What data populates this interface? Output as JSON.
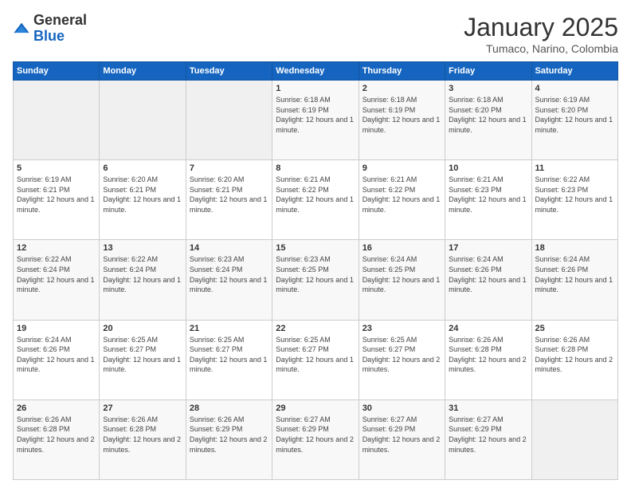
{
  "logo": {
    "general": "General",
    "blue": "Blue"
  },
  "header": {
    "title": "January 2025",
    "subtitle": "Tumaco, Narino, Colombia"
  },
  "days_of_week": [
    "Sunday",
    "Monday",
    "Tuesday",
    "Wednesday",
    "Thursday",
    "Friday",
    "Saturday"
  ],
  "weeks": [
    [
      {
        "day": "",
        "sunrise": "",
        "sunset": "",
        "daylight": "",
        "empty": true
      },
      {
        "day": "",
        "sunrise": "",
        "sunset": "",
        "daylight": "",
        "empty": true
      },
      {
        "day": "",
        "sunrise": "",
        "sunset": "",
        "daylight": "",
        "empty": true
      },
      {
        "day": "1",
        "sunrise": "Sunrise: 6:18 AM",
        "sunset": "Sunset: 6:19 PM",
        "daylight": "Daylight: 12 hours and 1 minute."
      },
      {
        "day": "2",
        "sunrise": "Sunrise: 6:18 AM",
        "sunset": "Sunset: 6:19 PM",
        "daylight": "Daylight: 12 hours and 1 minute."
      },
      {
        "day": "3",
        "sunrise": "Sunrise: 6:18 AM",
        "sunset": "Sunset: 6:20 PM",
        "daylight": "Daylight: 12 hours and 1 minute."
      },
      {
        "day": "4",
        "sunrise": "Sunrise: 6:19 AM",
        "sunset": "Sunset: 6:20 PM",
        "daylight": "Daylight: 12 hours and 1 minute."
      }
    ],
    [
      {
        "day": "5",
        "sunrise": "Sunrise: 6:19 AM",
        "sunset": "Sunset: 6:21 PM",
        "daylight": "Daylight: 12 hours and 1 minute."
      },
      {
        "day": "6",
        "sunrise": "Sunrise: 6:20 AM",
        "sunset": "Sunset: 6:21 PM",
        "daylight": "Daylight: 12 hours and 1 minute."
      },
      {
        "day": "7",
        "sunrise": "Sunrise: 6:20 AM",
        "sunset": "Sunset: 6:21 PM",
        "daylight": "Daylight: 12 hours and 1 minute."
      },
      {
        "day": "8",
        "sunrise": "Sunrise: 6:21 AM",
        "sunset": "Sunset: 6:22 PM",
        "daylight": "Daylight: 12 hours and 1 minute."
      },
      {
        "day": "9",
        "sunrise": "Sunrise: 6:21 AM",
        "sunset": "Sunset: 6:22 PM",
        "daylight": "Daylight: 12 hours and 1 minute."
      },
      {
        "day": "10",
        "sunrise": "Sunrise: 6:21 AM",
        "sunset": "Sunset: 6:23 PM",
        "daylight": "Daylight: 12 hours and 1 minute."
      },
      {
        "day": "11",
        "sunrise": "Sunrise: 6:22 AM",
        "sunset": "Sunset: 6:23 PM",
        "daylight": "Daylight: 12 hours and 1 minute."
      }
    ],
    [
      {
        "day": "12",
        "sunrise": "Sunrise: 6:22 AM",
        "sunset": "Sunset: 6:24 PM",
        "daylight": "Daylight: 12 hours and 1 minute."
      },
      {
        "day": "13",
        "sunrise": "Sunrise: 6:22 AM",
        "sunset": "Sunset: 6:24 PM",
        "daylight": "Daylight: 12 hours and 1 minute."
      },
      {
        "day": "14",
        "sunrise": "Sunrise: 6:23 AM",
        "sunset": "Sunset: 6:24 PM",
        "daylight": "Daylight: 12 hours and 1 minute."
      },
      {
        "day": "15",
        "sunrise": "Sunrise: 6:23 AM",
        "sunset": "Sunset: 6:25 PM",
        "daylight": "Daylight: 12 hours and 1 minute."
      },
      {
        "day": "16",
        "sunrise": "Sunrise: 6:24 AM",
        "sunset": "Sunset: 6:25 PM",
        "daylight": "Daylight: 12 hours and 1 minute."
      },
      {
        "day": "17",
        "sunrise": "Sunrise: 6:24 AM",
        "sunset": "Sunset: 6:26 PM",
        "daylight": "Daylight: 12 hours and 1 minute."
      },
      {
        "day": "18",
        "sunrise": "Sunrise: 6:24 AM",
        "sunset": "Sunset: 6:26 PM",
        "daylight": "Daylight: 12 hours and 1 minute."
      }
    ],
    [
      {
        "day": "19",
        "sunrise": "Sunrise: 6:24 AM",
        "sunset": "Sunset: 6:26 PM",
        "daylight": "Daylight: 12 hours and 1 minute."
      },
      {
        "day": "20",
        "sunrise": "Sunrise: 6:25 AM",
        "sunset": "Sunset: 6:27 PM",
        "daylight": "Daylight: 12 hours and 1 minute."
      },
      {
        "day": "21",
        "sunrise": "Sunrise: 6:25 AM",
        "sunset": "Sunset: 6:27 PM",
        "daylight": "Daylight: 12 hours and 1 minute."
      },
      {
        "day": "22",
        "sunrise": "Sunrise: 6:25 AM",
        "sunset": "Sunset: 6:27 PM",
        "daylight": "Daylight: 12 hours and 1 minute."
      },
      {
        "day": "23",
        "sunrise": "Sunrise: 6:25 AM",
        "sunset": "Sunset: 6:27 PM",
        "daylight": "Daylight: 12 hours and 2 minutes."
      },
      {
        "day": "24",
        "sunrise": "Sunrise: 6:26 AM",
        "sunset": "Sunset: 6:28 PM",
        "daylight": "Daylight: 12 hours and 2 minutes."
      },
      {
        "day": "25",
        "sunrise": "Sunrise: 6:26 AM",
        "sunset": "Sunset: 6:28 PM",
        "daylight": "Daylight: 12 hours and 2 minutes."
      }
    ],
    [
      {
        "day": "26",
        "sunrise": "Sunrise: 6:26 AM",
        "sunset": "Sunset: 6:28 PM",
        "daylight": "Daylight: 12 hours and 2 minutes."
      },
      {
        "day": "27",
        "sunrise": "Sunrise: 6:26 AM",
        "sunset": "Sunset: 6:28 PM",
        "daylight": "Daylight: 12 hours and 2 minutes."
      },
      {
        "day": "28",
        "sunrise": "Sunrise: 6:26 AM",
        "sunset": "Sunset: 6:29 PM",
        "daylight": "Daylight: 12 hours and 2 minutes."
      },
      {
        "day": "29",
        "sunrise": "Sunrise: 6:27 AM",
        "sunset": "Sunset: 6:29 PM",
        "daylight": "Daylight: 12 hours and 2 minutes."
      },
      {
        "day": "30",
        "sunrise": "Sunrise: 6:27 AM",
        "sunset": "Sunset: 6:29 PM",
        "daylight": "Daylight: 12 hours and 2 minutes."
      },
      {
        "day": "31",
        "sunrise": "Sunrise: 6:27 AM",
        "sunset": "Sunset: 6:29 PM",
        "daylight": "Daylight: 12 hours and 2 minutes."
      },
      {
        "day": "",
        "sunrise": "",
        "sunset": "",
        "daylight": "",
        "empty": true
      }
    ]
  ]
}
